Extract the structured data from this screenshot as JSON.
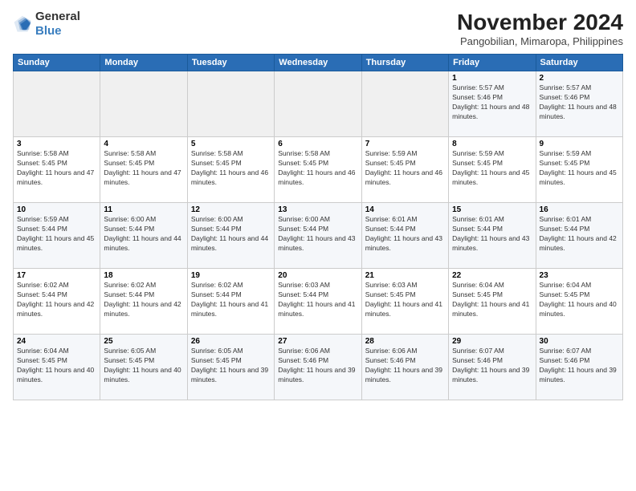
{
  "logo": {
    "general": "General",
    "blue": "Blue"
  },
  "header": {
    "month": "November 2024",
    "location": "Pangobilian, Mimaropa, Philippines"
  },
  "weekdays": [
    "Sunday",
    "Monday",
    "Tuesday",
    "Wednesday",
    "Thursday",
    "Friday",
    "Saturday"
  ],
  "weeks": [
    [
      {
        "day": "",
        "info": ""
      },
      {
        "day": "",
        "info": ""
      },
      {
        "day": "",
        "info": ""
      },
      {
        "day": "",
        "info": ""
      },
      {
        "day": "",
        "info": ""
      },
      {
        "day": "1",
        "sunrise": "5:57 AM",
        "sunset": "5:46 PM",
        "daylight": "11 hours and 48 minutes."
      },
      {
        "day": "2",
        "sunrise": "5:57 AM",
        "sunset": "5:46 PM",
        "daylight": "11 hours and 48 minutes."
      }
    ],
    [
      {
        "day": "3",
        "sunrise": "5:58 AM",
        "sunset": "5:45 PM",
        "daylight": "11 hours and 47 minutes."
      },
      {
        "day": "4",
        "sunrise": "5:58 AM",
        "sunset": "5:45 PM",
        "daylight": "11 hours and 47 minutes."
      },
      {
        "day": "5",
        "sunrise": "5:58 AM",
        "sunset": "5:45 PM",
        "daylight": "11 hours and 46 minutes."
      },
      {
        "day": "6",
        "sunrise": "5:58 AM",
        "sunset": "5:45 PM",
        "daylight": "11 hours and 46 minutes."
      },
      {
        "day": "7",
        "sunrise": "5:59 AM",
        "sunset": "5:45 PM",
        "daylight": "11 hours and 46 minutes."
      },
      {
        "day": "8",
        "sunrise": "5:59 AM",
        "sunset": "5:45 PM",
        "daylight": "11 hours and 45 minutes."
      },
      {
        "day": "9",
        "sunrise": "5:59 AM",
        "sunset": "5:45 PM",
        "daylight": "11 hours and 45 minutes."
      }
    ],
    [
      {
        "day": "10",
        "sunrise": "5:59 AM",
        "sunset": "5:44 PM",
        "daylight": "11 hours and 45 minutes."
      },
      {
        "day": "11",
        "sunrise": "6:00 AM",
        "sunset": "5:44 PM",
        "daylight": "11 hours and 44 minutes."
      },
      {
        "day": "12",
        "sunrise": "6:00 AM",
        "sunset": "5:44 PM",
        "daylight": "11 hours and 44 minutes."
      },
      {
        "day": "13",
        "sunrise": "6:00 AM",
        "sunset": "5:44 PM",
        "daylight": "11 hours and 43 minutes."
      },
      {
        "day": "14",
        "sunrise": "6:01 AM",
        "sunset": "5:44 PM",
        "daylight": "11 hours and 43 minutes."
      },
      {
        "day": "15",
        "sunrise": "6:01 AM",
        "sunset": "5:44 PM",
        "daylight": "11 hours and 43 minutes."
      },
      {
        "day": "16",
        "sunrise": "6:01 AM",
        "sunset": "5:44 PM",
        "daylight": "11 hours and 42 minutes."
      }
    ],
    [
      {
        "day": "17",
        "sunrise": "6:02 AM",
        "sunset": "5:44 PM",
        "daylight": "11 hours and 42 minutes."
      },
      {
        "day": "18",
        "sunrise": "6:02 AM",
        "sunset": "5:44 PM",
        "daylight": "11 hours and 42 minutes."
      },
      {
        "day": "19",
        "sunrise": "6:02 AM",
        "sunset": "5:44 PM",
        "daylight": "11 hours and 41 minutes."
      },
      {
        "day": "20",
        "sunrise": "6:03 AM",
        "sunset": "5:44 PM",
        "daylight": "11 hours and 41 minutes."
      },
      {
        "day": "21",
        "sunrise": "6:03 AM",
        "sunset": "5:45 PM",
        "daylight": "11 hours and 41 minutes."
      },
      {
        "day": "22",
        "sunrise": "6:04 AM",
        "sunset": "5:45 PM",
        "daylight": "11 hours and 41 minutes."
      },
      {
        "day": "23",
        "sunrise": "6:04 AM",
        "sunset": "5:45 PM",
        "daylight": "11 hours and 40 minutes."
      }
    ],
    [
      {
        "day": "24",
        "sunrise": "6:04 AM",
        "sunset": "5:45 PM",
        "daylight": "11 hours and 40 minutes."
      },
      {
        "day": "25",
        "sunrise": "6:05 AM",
        "sunset": "5:45 PM",
        "daylight": "11 hours and 40 minutes."
      },
      {
        "day": "26",
        "sunrise": "6:05 AM",
        "sunset": "5:45 PM",
        "daylight": "11 hours and 39 minutes."
      },
      {
        "day": "27",
        "sunrise": "6:06 AM",
        "sunset": "5:46 PM",
        "daylight": "11 hours and 39 minutes."
      },
      {
        "day": "28",
        "sunrise": "6:06 AM",
        "sunset": "5:46 PM",
        "daylight": "11 hours and 39 minutes."
      },
      {
        "day": "29",
        "sunrise": "6:07 AM",
        "sunset": "5:46 PM",
        "daylight": "11 hours and 39 minutes."
      },
      {
        "day": "30",
        "sunrise": "6:07 AM",
        "sunset": "5:46 PM",
        "daylight": "11 hours and 39 minutes."
      }
    ]
  ]
}
